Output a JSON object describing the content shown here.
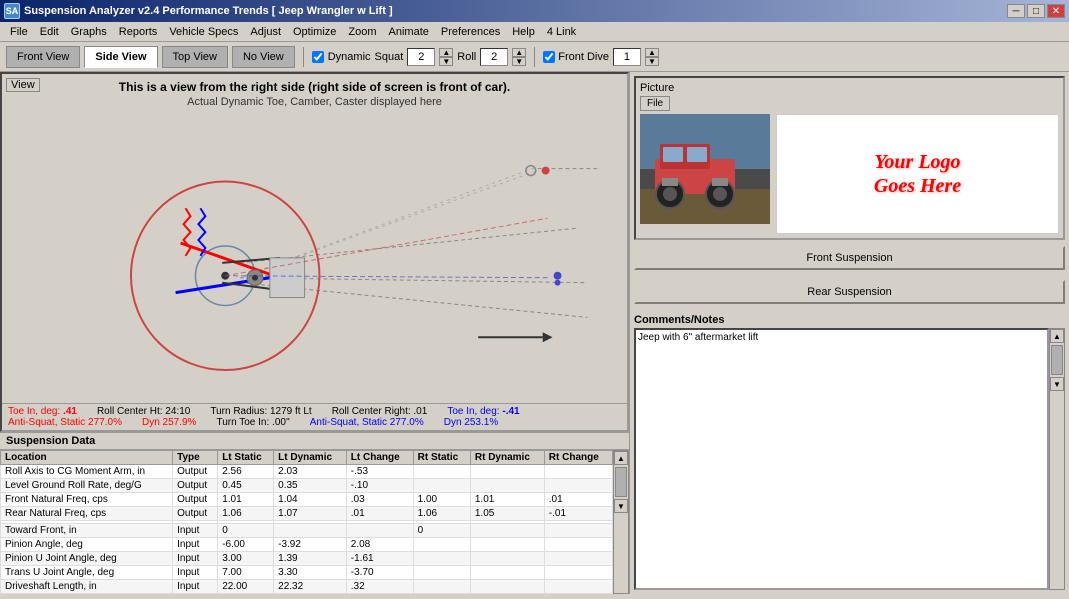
{
  "titlebar": {
    "title": "Suspension Analyzer v2.4   Performance Trends   [ Jeep Wrangler w Lift ]",
    "icon_label": "SA",
    "btn_minimize": "─",
    "btn_maximize": "□",
    "btn_close": "✕"
  },
  "menubar": {
    "items": [
      "File",
      "Edit",
      "Graphs",
      "Reports",
      "Vehicle Specs",
      "Adjust",
      "Optimize",
      "Zoom",
      "Animate",
      "Preferences",
      "Help",
      "4 Link"
    ]
  },
  "toolbar": {
    "tabs": [
      {
        "label": "Front View",
        "active": false
      },
      {
        "label": "Side View",
        "active": true
      },
      {
        "label": "Top View",
        "active": false
      },
      {
        "label": "No View",
        "active": false
      }
    ],
    "dynamic_label": "Dynamic",
    "squat_label": "Squat",
    "squat_value": "2",
    "roll_label": "Roll",
    "roll_value": "2",
    "front_dive_label": "Front Dive",
    "front_dive_value": "1"
  },
  "view": {
    "label": "View",
    "title": "This is a view from the right side (right side of screen is front of car).",
    "subtitle": "Actual Dynamic Toe, Camber, Caster displayed here"
  },
  "status": {
    "row1": [
      {
        "label": "Toe In, deg:",
        "value": ".41",
        "color": "red"
      },
      {
        "label": "Roll Center Ht:",
        "value": "24.10",
        "color": "black"
      },
      {
        "label": "Turn Radius:",
        "value": "1279 ft Lt",
        "color": "black"
      },
      {
        "label": "Roll Center Right:",
        "value": ".01",
        "color": "black"
      },
      {
        "label": "Toe In, deg:",
        "value": "-.41",
        "color": "blue"
      }
    ],
    "row2": [
      {
        "label": "Anti-Squat, Static",
        "value": "277.0%",
        "color": "red"
      },
      {
        "label": "Dyn",
        "value": "257.9%",
        "color": "red"
      },
      {
        "label": "Turn Toe In:",
        "value": ".00\"",
        "color": "black"
      },
      {
        "label": "Anti-Squat, Static",
        "value": "277.0%",
        "color": "blue"
      },
      {
        "label": "Dyn",
        "value": "253.1%",
        "color": "blue"
      }
    ]
  },
  "table": {
    "header": "Suspension Data",
    "columns": [
      "Location",
      "Type",
      "Lt Static",
      "Lt Dynamic",
      "Lt Change",
      "Rt Static",
      "Rt Dynamic",
      "Rt Change"
    ],
    "rows": [
      [
        "Roll Axis to CG Moment Arm, in",
        "Output",
        "2.56",
        "2.03",
        "-.53",
        "",
        "",
        ""
      ],
      [
        "Level Ground Roll Rate, deg/G",
        "Output",
        "0.45",
        "0.35",
        "-.10",
        "",
        "",
        ""
      ],
      [
        "Front Natural Freq, cps",
        "Output",
        "1.01",
        "1.04",
        ".03",
        "1.00",
        "1.01",
        ".01"
      ],
      [
        "Rear Natural Freq, cps",
        "Output",
        "1.06",
        "1.07",
        ".01",
        "1.06",
        "1.05",
        "-.01"
      ],
      [
        "",
        "",
        "",
        "",
        "",
        "",
        "",
        ""
      ],
      [
        "Toward Front, in",
        "Input",
        "0",
        "",
        "",
        "0",
        "",
        ""
      ],
      [
        "Pinion Angle, deg",
        "Input",
        "-6.00",
        "-3.92",
        "2.08",
        "",
        "",
        ""
      ],
      [
        "Pinion U Joint Angle, deg",
        "Input",
        "3.00",
        "1.39",
        "-1.61",
        "",
        "",
        ""
      ],
      [
        "Trans U Joint Angle, deg",
        "Input",
        "7.00",
        "3.30",
        "-3.70",
        "",
        "",
        ""
      ],
      [
        "Driveshaft Length, in",
        "Input",
        "22.00",
        "22.32",
        ".32",
        "",
        "",
        ""
      ]
    ]
  },
  "picture": {
    "header": "Picture",
    "file_btn": "File"
  },
  "logo": {
    "line1": "Your Logo",
    "line2": "Goes Here"
  },
  "buttons": {
    "front_suspension": "Front Suspension",
    "rear_suspension": "Rear Suspension"
  },
  "comments": {
    "header": "Comments/Notes",
    "text": "Jeep with 6\" aftermarket lift",
    "placeholder": ""
  }
}
